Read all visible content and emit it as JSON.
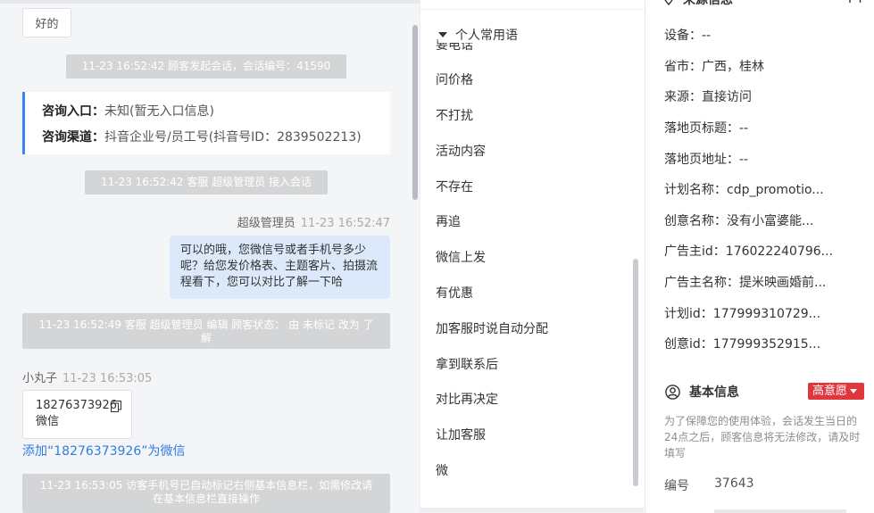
{
  "chat": {
    "quick_reply": "好的",
    "sys_session_start": "11-23 16:52:42 顾客发起会话，会话编号：41590",
    "consult_entry_label": "咨询入口：",
    "consult_entry_value": "未知(暂无入口信息)",
    "consult_channel_label": "咨询渠道：",
    "consult_channel_value": "抖音企业号/员工号(抖音号ID：2839502213)",
    "sys_agent_join": "11-23 16:52:42 客服 超级管理员 接入会话",
    "agent_name": "超级管理员",
    "agent_time": "11-23 16:52:47",
    "agent_message": "可以的哦，您微信号或者手机号多少呢？给您发价格表、主题客片、拍摄流程看下，您可以对比了解一下哈",
    "sys_status_edit": "11-23 16:52:49 客服 超级管理员 编辑 顾客状态： 由 未标记 改为 了解",
    "customer_name": "小丸子",
    "customer_time": "11-23 16:53:05",
    "phone_number": "18276373926",
    "phone_caption": "微信",
    "add_wechat_link": "添加“18276373926”为微信",
    "sys_phone_marked": "11-23 16:53:05 访客手机号已自动标记右侧基本信息栏，如需修改请在基本信息栏直接操作"
  },
  "phrases": {
    "group_title": "个人常用语",
    "partial_item": "要电话",
    "items": [
      "问价格",
      "不打扰",
      "活动内容",
      "不存在",
      "再追",
      "微信上发",
      "有优惠",
      "加客服时说自动分配",
      "拿到联系后",
      "对比再决定",
      "让加客服",
      "微"
    ]
  },
  "info": {
    "source_title": "来源信息",
    "fields": [
      {
        "label": "设备：",
        "value": "--"
      },
      {
        "label": "省市：",
        "value": "广西，桂林"
      },
      {
        "label": "来源：",
        "value": "直接访问"
      },
      {
        "label": "落地页标题：",
        "value": "--"
      },
      {
        "label": "落地页地址：",
        "value": "--"
      },
      {
        "label": "计划名称：",
        "value": "cdp_promotio..."
      },
      {
        "label": "创意名称：",
        "value": "没有小富婆能..."
      },
      {
        "label": "广告主id：",
        "value": "176022240796..."
      },
      {
        "label": "广告主名称：",
        "value": "提米映画婚前..."
      },
      {
        "label": "计划id：",
        "value": "177999310729..."
      },
      {
        "label": "创意id：",
        "value": "177999352915..."
      }
    ],
    "basic_title": "基本信息",
    "intent_badge": "高意愿",
    "notice": "为了保障您的使用体验，会话发生当日的24点之后，顾客信息将无法修改，请及时填写",
    "serial_label": "编号",
    "serial_value": "37643"
  },
  "colors": {
    "accent_blue": "#3b82f6",
    "agent_bubble": "#dbe9fb",
    "system_notice": "#d4d5d7",
    "link": "#2f7de1",
    "intent_red": "#e0363c"
  },
  "icons": {
    "copy": "copy-icon",
    "collapse": "triangle-down-icon",
    "location": "location-pin-icon",
    "user": "user-circle-icon",
    "dropdown": "caret-down-icon"
  }
}
